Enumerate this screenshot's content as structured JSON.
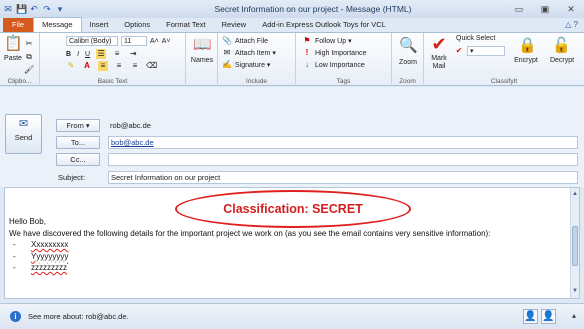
{
  "window": {
    "title": "Secret Information on our project  -  Message (HTML)",
    "minimize": "▭",
    "maximize": "▣",
    "close": "✕"
  },
  "qat": [
    "✉",
    "💾",
    "↶",
    "↷",
    "▾"
  ],
  "tabs": {
    "file": "File",
    "message": "Message",
    "insert": "Insert",
    "options": "Options",
    "format_text": "Format Text",
    "review": "Review",
    "addin": "Add-in Express Outlook Toys for VCL",
    "help": "△ ?"
  },
  "ribbon": {
    "clipboard": {
      "paste": "Paste",
      "label": "Clipbo..."
    },
    "basic_text": {
      "font": "Calibri (Body)",
      "size": "11",
      "grow": "A˄",
      "shrink": "A˅",
      "bold": "B",
      "italic": "I",
      "underline": "U",
      "label": "Basic Text"
    },
    "names": {
      "label": "Names"
    },
    "include": {
      "attach_file": "Attach File",
      "attach_item": "Attach Item ▾",
      "signature": "Signature ▾",
      "label": "Include"
    },
    "tags": {
      "follow_up": "Follow Up ▾",
      "high": "High Importance",
      "low": "Low Importance",
      "label": "Tags"
    },
    "zoom": {
      "zoom": "Zoom",
      "label": "Zoom"
    },
    "classifyit": {
      "mark_mail": "Mark Mail",
      "quick_select": "Quick Select",
      "encrypt": "Encrypt",
      "decrypt": "Decrypt",
      "label": "ClassifyIt"
    }
  },
  "header": {
    "send": "Send",
    "from_btn": "From ▾",
    "from_value": "rob@abc.de",
    "to_btn": "To...",
    "to_value": "bob@abc.de",
    "cc_btn": "Cc...",
    "cc_value": "",
    "subject_label": "Subject:",
    "subject_value": "Secret Information on our project"
  },
  "body": {
    "classification": "Classification: SECRET",
    "greeting": "Hello Bob,",
    "paragraph": "We have discovered the following details for the important project we work on (as you see the email contains very sensitive information):",
    "items": [
      "Xxxxxxxxx",
      "Yyyyyyyyy",
      "zzzzzzzzz"
    ]
  },
  "status": {
    "info_icon": "i",
    "text": "See more about: rob@abc.de."
  },
  "colors": {
    "file_tab": "#d55a1e",
    "classification_red": "#d21f1f",
    "accent_blue": "#2a5ca8"
  }
}
